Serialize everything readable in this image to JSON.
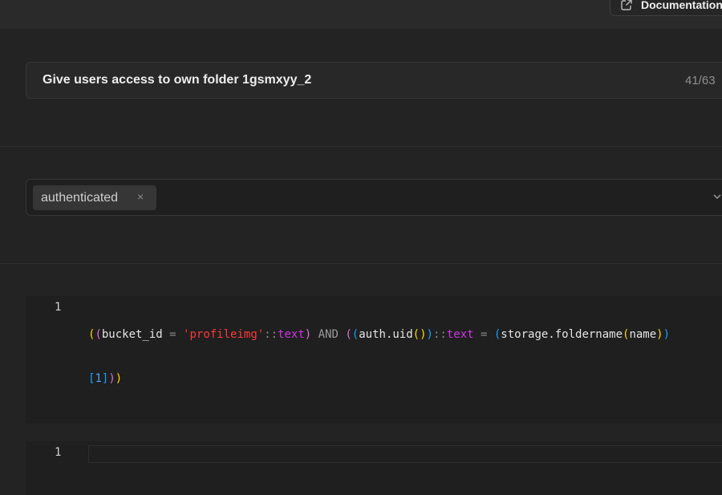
{
  "header": {
    "documentation_label": "Documentation",
    "documentation_icon": "external-link-icon"
  },
  "policy_name": {
    "value": "Give users access to own folder 1gsmxyy_2",
    "counter": "41/63"
  },
  "roles": {
    "selected": [
      "authenticated"
    ],
    "remove_glyph": "×"
  },
  "using_editor": {
    "line_number": "1",
    "tokens_line1": [
      "(",
      "(",
      "bucket_id",
      " = ",
      "'profileimg'",
      "::",
      "text",
      ")",
      " AND ",
      "(",
      "(",
      "auth.uid",
      "(",
      ")",
      ")",
      "::",
      "text",
      " = ",
      "(",
      "storage.foldername",
      "(",
      "name",
      ")",
      ")"
    ],
    "tokens_line2": [
      "[",
      "1",
      "]",
      ")",
      ")"
    ]
  },
  "check_editor": {
    "line_number": "1",
    "code": ""
  },
  "colors": {
    "bracket_level1": "#ffd700",
    "bracket_level2": "#da70d6",
    "bracket_level3": "#179fff",
    "string": "#ff3838",
    "keyword": "#d033e8"
  }
}
